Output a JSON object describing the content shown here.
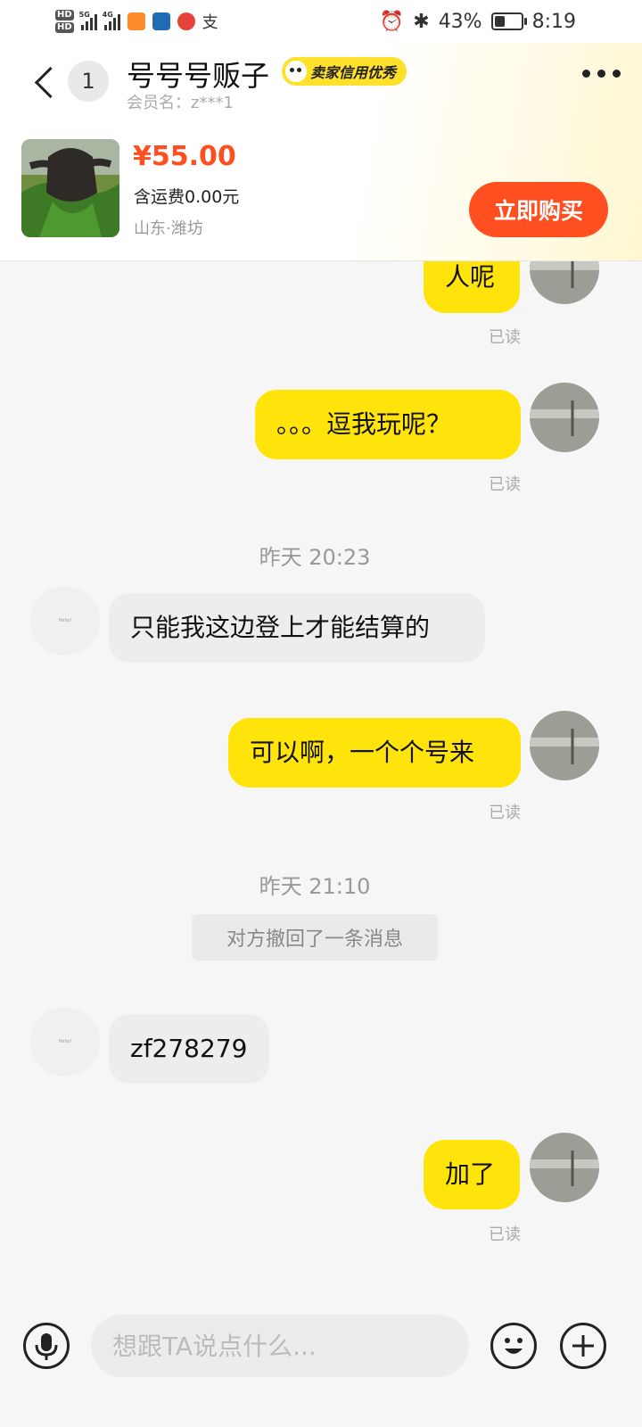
{
  "status_bar": {
    "hd1": "HD",
    "hd2": "HD",
    "net1": "5G",
    "net2": "4G",
    "battery": "43%",
    "battery_level": 0.43,
    "time": "8:19"
  },
  "header": {
    "unread_count": "1",
    "title": "号号号贩子",
    "badge": "卖家信用优秀",
    "member": "会员名：z***1"
  },
  "product": {
    "price": "¥55.00",
    "shipping": "含运费0.00元",
    "location": "山东·潍坊",
    "buy_label": "立即购买"
  },
  "messages": [
    {
      "from": "me",
      "text": "人呢",
      "read": "已读"
    },
    {
      "from": "me",
      "text": "。。。逗我玩呢？",
      "read": "已读"
    },
    {
      "time": "昨天 20:23"
    },
    {
      "from": "them",
      "text": "只能我这边登上才能结算的",
      "avatar_text": "Hello!"
    },
    {
      "from": "me",
      "text": "可以啊，一个个号来",
      "read": "已读"
    },
    {
      "time": "昨天 21:10"
    },
    {
      "recall": "对方撤回了一条消息"
    },
    {
      "from": "them",
      "text": "zf278279",
      "avatar_text": "Hello!"
    },
    {
      "from": "me",
      "text": "加了",
      "read": "已读"
    }
  ],
  "input": {
    "placeholder": "想跟TA说点什么..."
  },
  "icons": {
    "mic": "microphone-icon",
    "emoji": "smiley-icon",
    "plus": "plus-icon"
  },
  "colors": {
    "accent": "#ff4e1f",
    "bubble_me": "#ffe40c",
    "bubble_them": "#ededed",
    "badge": "#ffe02a"
  }
}
